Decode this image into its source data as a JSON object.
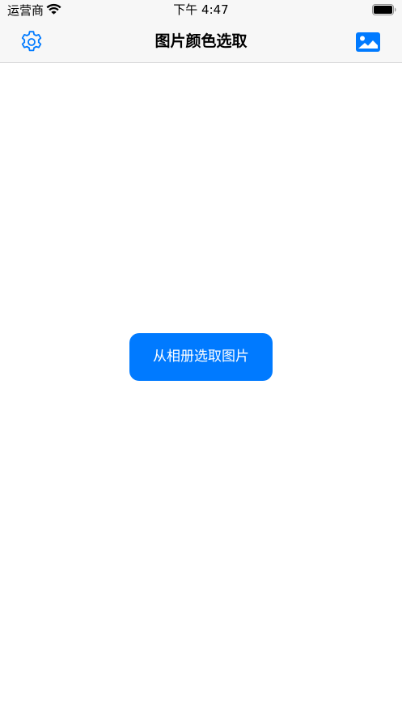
{
  "status_bar": {
    "carrier": "运营商",
    "time": "下午 4:47",
    "wifi_icon": "wifi-icon",
    "battery_icon": "battery-icon"
  },
  "nav_bar": {
    "title": "图片颜色选取",
    "left_icon": "gear-icon",
    "right_icon": "photo-icon"
  },
  "main": {
    "pick_button_label": "从相册选取图片"
  },
  "colors": {
    "accent": "#007aff",
    "bar_background": "#f7f7f7",
    "background": "#ffffff"
  }
}
